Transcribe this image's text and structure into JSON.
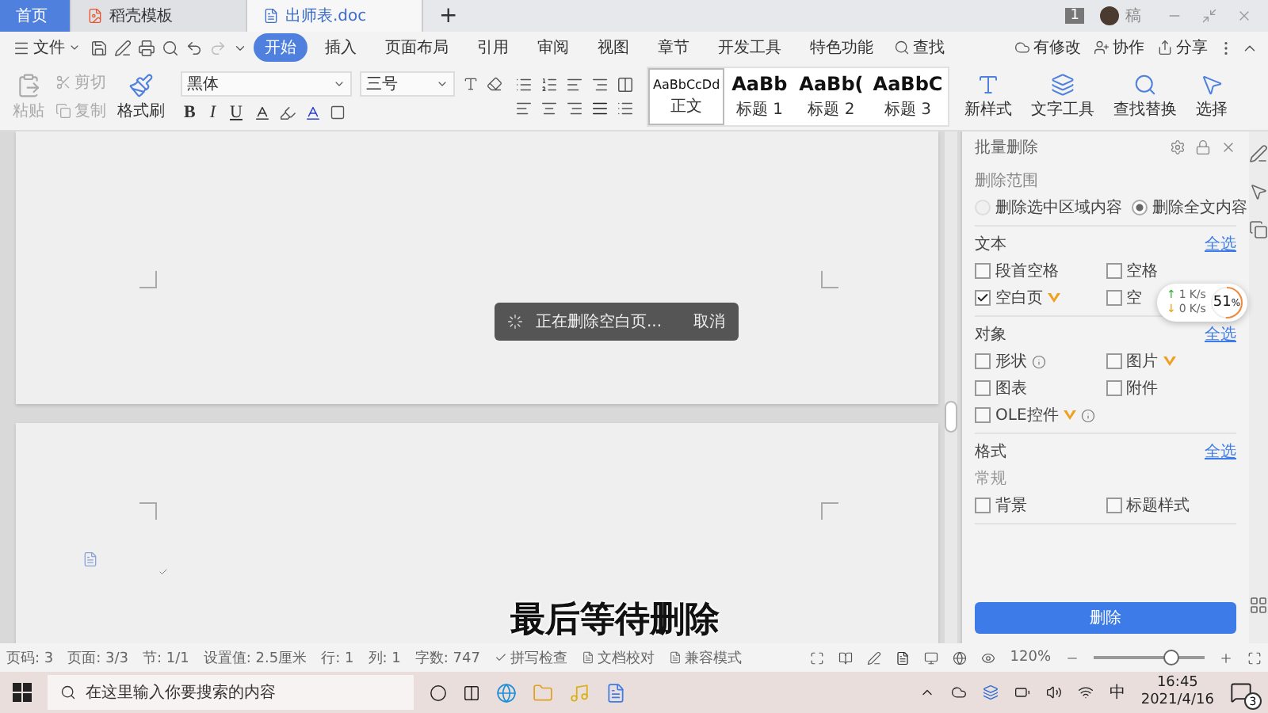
{
  "title_bar": {
    "tabs": [
      {
        "label": "首页",
        "kind": "home",
        "selected": false
      },
      {
        "label": "稻壳模板",
        "kind": "template",
        "selected": false
      },
      {
        "label": "出师表.doc",
        "kind": "document",
        "selected": true
      }
    ],
    "new_tab": "+",
    "badge": "1",
    "user": "稿"
  },
  "menu_bar": {
    "file": "文件",
    "tabs": [
      {
        "label": "开始",
        "selected": true
      },
      {
        "label": "插入",
        "selected": false
      },
      {
        "label": "页面布局",
        "selected": false
      },
      {
        "label": "引用",
        "selected": false
      },
      {
        "label": "审阅",
        "selected": false
      },
      {
        "label": "视图",
        "selected": false
      },
      {
        "label": "章节",
        "selected": false
      },
      {
        "label": "开发工具",
        "selected": false
      },
      {
        "label": "特色功能",
        "selected": false
      }
    ],
    "search": "查找",
    "actions": [
      "有修改",
      "协作",
      "分享"
    ]
  },
  "ribbon": {
    "clipboard": [
      {
        "label": "粘贴",
        "disabled": true
      },
      {
        "label": "剪切",
        "disabled": true
      },
      {
        "label": "复制",
        "disabled": true
      },
      {
        "label": "格式刷",
        "disabled": false
      }
    ],
    "font": "黑体",
    "font_size": "三号",
    "text_styles": [
      "B",
      "I",
      "U"
    ],
    "styles": [
      {
        "preview": "AaBbCcDd",
        "label": "正文",
        "selected": true
      },
      {
        "preview": "AaBb",
        "label": "标题 1",
        "selected": false
      },
      {
        "preview": "AaBb(",
        "label": "标题 2",
        "selected": false
      },
      {
        "preview": "AaBbC",
        "label": "标题 3",
        "selected": false
      }
    ],
    "tools": [
      "新样式",
      "文字工具",
      "查找替换",
      "选择"
    ]
  },
  "progress_toast": {
    "message": "正在删除空白页...",
    "cancel": "取消"
  },
  "panel": {
    "title": "批量删除",
    "range": {
      "title": "删除范围",
      "options": [
        {
          "label": "删除选中区域内容",
          "selected": false
        },
        {
          "label": "删除全文内容",
          "selected": true
        }
      ]
    },
    "sections": [
      {
        "title": "文本",
        "select_all": "全选",
        "items": [
          {
            "label": "段首空格",
            "checked": false,
            "vip": false,
            "info": false
          },
          {
            "label": "空格",
            "checked": false,
            "vip": false,
            "info": false
          },
          {
            "label": "空白页",
            "checked": true,
            "vip": true,
            "info": false
          },
          {
            "label": "空",
            "checked": false,
            "vip": false,
            "info": false
          }
        ]
      },
      {
        "title": "对象",
        "select_all": "全选",
        "items": [
          {
            "label": "形状",
            "checked": false,
            "vip": false,
            "info": true
          },
          {
            "label": "图片",
            "checked": false,
            "vip": true,
            "info": false
          },
          {
            "label": "图表",
            "checked": false,
            "vip": false,
            "info": false
          },
          {
            "label": "附件",
            "checked": false,
            "vip": false,
            "info": false
          },
          {
            "label": "OLE控件",
            "checked": false,
            "vip": true,
            "info": true
          }
        ]
      },
      {
        "title": "格式",
        "select_all": "全选",
        "subtitle": "常规",
        "items": [
          {
            "label": "背景",
            "checked": false,
            "vip": false,
            "info": false
          },
          {
            "label": "标题样式",
            "checked": false,
            "vip": false,
            "info": false
          }
        ]
      }
    ],
    "delete_button": "删除"
  },
  "speed_widget": {
    "upload_arrow": "↑",
    "download_arrow": "↓",
    "upload": "1",
    "upload_unit": "K/s",
    "download": "0",
    "download_unit": "K/s",
    "percent": "51",
    "percent_sign": "%",
    "level": 0.51
  },
  "subtitle": "最后等待删除",
  "status_bar": {
    "items": [
      "页码: 3",
      "页面: 3/3",
      "节: 1/1",
      "设置值: 2.5厘米",
      "行: 1",
      "列: 1",
      "字数: 747"
    ],
    "checks": [
      "拼写检查",
      "文档校对",
      "兼容模式"
    ],
    "zoom": "120%",
    "zoom_slider": {
      "level": 0.7
    }
  },
  "taskbar": {
    "search": {
      "placeholder": "在这里输入你要搜索的内容"
    },
    "ime": "中",
    "time": "16:45",
    "date": "2021/4/16",
    "notifications": "3"
  }
}
